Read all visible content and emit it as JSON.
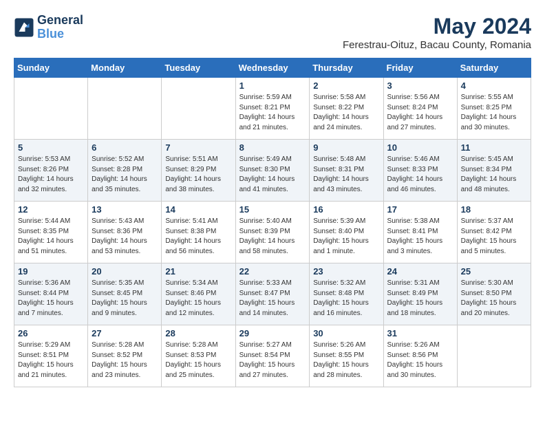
{
  "header": {
    "logo_line1": "General",
    "logo_line2": "Blue",
    "month_year": "May 2024",
    "location": "Ferestrau-Oituz, Bacau County, Romania"
  },
  "weekdays": [
    "Sunday",
    "Monday",
    "Tuesday",
    "Wednesday",
    "Thursday",
    "Friday",
    "Saturday"
  ],
  "weeks": [
    [
      {
        "day": "",
        "info": ""
      },
      {
        "day": "",
        "info": ""
      },
      {
        "day": "",
        "info": ""
      },
      {
        "day": "1",
        "info": "Sunrise: 5:59 AM\nSunset: 8:21 PM\nDaylight: 14 hours\nand 21 minutes."
      },
      {
        "day": "2",
        "info": "Sunrise: 5:58 AM\nSunset: 8:22 PM\nDaylight: 14 hours\nand 24 minutes."
      },
      {
        "day": "3",
        "info": "Sunrise: 5:56 AM\nSunset: 8:24 PM\nDaylight: 14 hours\nand 27 minutes."
      },
      {
        "day": "4",
        "info": "Sunrise: 5:55 AM\nSunset: 8:25 PM\nDaylight: 14 hours\nand 30 minutes."
      }
    ],
    [
      {
        "day": "5",
        "info": "Sunrise: 5:53 AM\nSunset: 8:26 PM\nDaylight: 14 hours\nand 32 minutes."
      },
      {
        "day": "6",
        "info": "Sunrise: 5:52 AM\nSunset: 8:28 PM\nDaylight: 14 hours\nand 35 minutes."
      },
      {
        "day": "7",
        "info": "Sunrise: 5:51 AM\nSunset: 8:29 PM\nDaylight: 14 hours\nand 38 minutes."
      },
      {
        "day": "8",
        "info": "Sunrise: 5:49 AM\nSunset: 8:30 PM\nDaylight: 14 hours\nand 41 minutes."
      },
      {
        "day": "9",
        "info": "Sunrise: 5:48 AM\nSunset: 8:31 PM\nDaylight: 14 hours\nand 43 minutes."
      },
      {
        "day": "10",
        "info": "Sunrise: 5:46 AM\nSunset: 8:33 PM\nDaylight: 14 hours\nand 46 minutes."
      },
      {
        "day": "11",
        "info": "Sunrise: 5:45 AM\nSunset: 8:34 PM\nDaylight: 14 hours\nand 48 minutes."
      }
    ],
    [
      {
        "day": "12",
        "info": "Sunrise: 5:44 AM\nSunset: 8:35 PM\nDaylight: 14 hours\nand 51 minutes."
      },
      {
        "day": "13",
        "info": "Sunrise: 5:43 AM\nSunset: 8:36 PM\nDaylight: 14 hours\nand 53 minutes."
      },
      {
        "day": "14",
        "info": "Sunrise: 5:41 AM\nSunset: 8:38 PM\nDaylight: 14 hours\nand 56 minutes."
      },
      {
        "day": "15",
        "info": "Sunrise: 5:40 AM\nSunset: 8:39 PM\nDaylight: 14 hours\nand 58 minutes."
      },
      {
        "day": "16",
        "info": "Sunrise: 5:39 AM\nSunset: 8:40 PM\nDaylight: 15 hours\nand 1 minute."
      },
      {
        "day": "17",
        "info": "Sunrise: 5:38 AM\nSunset: 8:41 PM\nDaylight: 15 hours\nand 3 minutes."
      },
      {
        "day": "18",
        "info": "Sunrise: 5:37 AM\nSunset: 8:42 PM\nDaylight: 15 hours\nand 5 minutes."
      }
    ],
    [
      {
        "day": "19",
        "info": "Sunrise: 5:36 AM\nSunset: 8:44 PM\nDaylight: 15 hours\nand 7 minutes."
      },
      {
        "day": "20",
        "info": "Sunrise: 5:35 AM\nSunset: 8:45 PM\nDaylight: 15 hours\nand 9 minutes."
      },
      {
        "day": "21",
        "info": "Sunrise: 5:34 AM\nSunset: 8:46 PM\nDaylight: 15 hours\nand 12 minutes."
      },
      {
        "day": "22",
        "info": "Sunrise: 5:33 AM\nSunset: 8:47 PM\nDaylight: 15 hours\nand 14 minutes."
      },
      {
        "day": "23",
        "info": "Sunrise: 5:32 AM\nSunset: 8:48 PM\nDaylight: 15 hours\nand 16 minutes."
      },
      {
        "day": "24",
        "info": "Sunrise: 5:31 AM\nSunset: 8:49 PM\nDaylight: 15 hours\nand 18 minutes."
      },
      {
        "day": "25",
        "info": "Sunrise: 5:30 AM\nSunset: 8:50 PM\nDaylight: 15 hours\nand 20 minutes."
      }
    ],
    [
      {
        "day": "26",
        "info": "Sunrise: 5:29 AM\nSunset: 8:51 PM\nDaylight: 15 hours\nand 21 minutes."
      },
      {
        "day": "27",
        "info": "Sunrise: 5:28 AM\nSunset: 8:52 PM\nDaylight: 15 hours\nand 23 minutes."
      },
      {
        "day": "28",
        "info": "Sunrise: 5:28 AM\nSunset: 8:53 PM\nDaylight: 15 hours\nand 25 minutes."
      },
      {
        "day": "29",
        "info": "Sunrise: 5:27 AM\nSunset: 8:54 PM\nDaylight: 15 hours\nand 27 minutes."
      },
      {
        "day": "30",
        "info": "Sunrise: 5:26 AM\nSunset: 8:55 PM\nDaylight: 15 hours\nand 28 minutes."
      },
      {
        "day": "31",
        "info": "Sunrise: 5:26 AM\nSunset: 8:56 PM\nDaylight: 15 hours\nand 30 minutes."
      },
      {
        "day": "",
        "info": ""
      }
    ]
  ]
}
